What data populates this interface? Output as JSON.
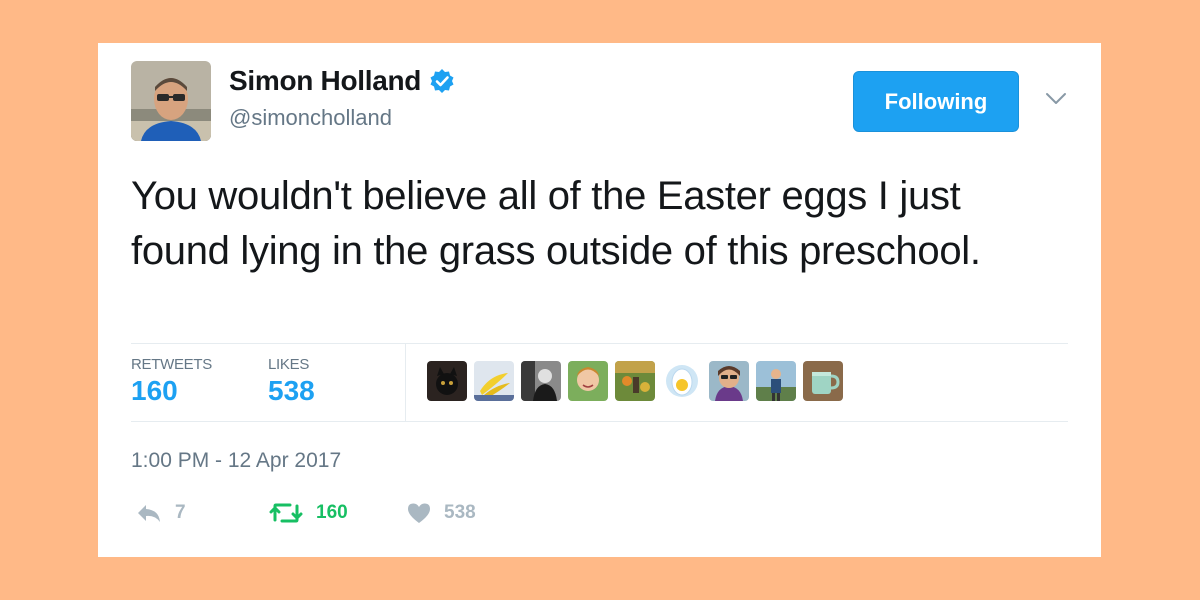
{
  "tweet": {
    "author": {
      "name": "Simon Holland",
      "handle": "@simoncholland",
      "avatar_icon": "profile-photo",
      "verified_icon": "verified-badge-icon"
    },
    "follow_button_label": "Following",
    "menu_icon": "chevron-down-icon",
    "text": "You wouldn't believe all of the Easter eggs I just found lying in the grass outside of this preschool.",
    "stats": {
      "retweets_label": "RETWEETS",
      "retweets_value": "160",
      "likes_label": "LIKES",
      "likes_value": "538"
    },
    "likers": [
      {
        "icon": "liker-avatar-black-cat"
      },
      {
        "icon": "liker-avatar-bananas"
      },
      {
        "icon": "liker-avatar-person-dark"
      },
      {
        "icon": "liker-avatar-person-smiling"
      },
      {
        "icon": "liker-avatar-garden"
      },
      {
        "icon": "liker-avatar-egg"
      },
      {
        "icon": "liker-avatar-woman-sunglasses"
      },
      {
        "icon": "liker-avatar-person-outdoors"
      },
      {
        "icon": "liker-avatar-mug"
      }
    ],
    "timestamp": "1:00 PM - 12 Apr 2017",
    "actions": {
      "reply_count": "7",
      "retweet_count": "160",
      "like_count": "538"
    }
  },
  "colors": {
    "background": "#ffb987",
    "accent_blue": "#1da1f2",
    "retweet_green": "#17bf63",
    "muted_gray": "#657786",
    "text_dark": "#14171a"
  }
}
